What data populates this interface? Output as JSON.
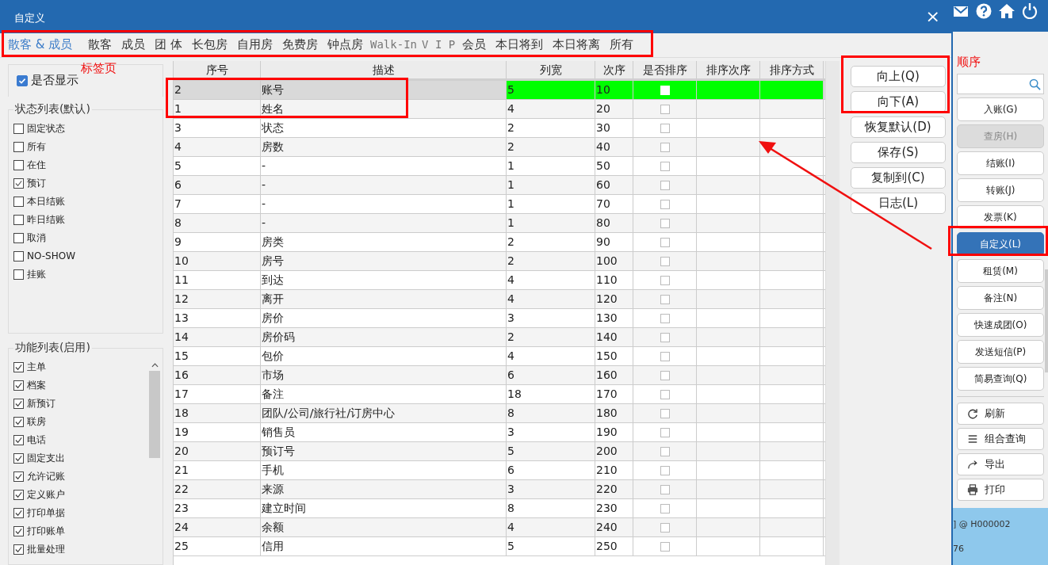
{
  "window": {
    "title": "自定义",
    "close": "×"
  },
  "tabs": [
    {
      "label": "散客 & 成员",
      "selected": true
    },
    {
      "label": "散客",
      "selected": false
    },
    {
      "label": "成员",
      "selected": false
    },
    {
      "label": "团 体",
      "selected": false
    },
    {
      "label": "长包房",
      "selected": false
    },
    {
      "label": "自用房",
      "selected": false
    },
    {
      "label": "免费房",
      "selected": false
    },
    {
      "label": "钟点房",
      "selected": false
    },
    {
      "label": "Walk-In",
      "selected": false,
      "kind": "mono"
    },
    {
      "label": "V I P",
      "selected": false,
      "kind": "mono"
    },
    {
      "label": "会员",
      "selected": false
    },
    {
      "label": "本日将到",
      "selected": false
    },
    {
      "label": "本日将离",
      "selected": false
    },
    {
      "label": "所有",
      "selected": false
    }
  ],
  "show_toggle": {
    "label": "是否显示",
    "checked": true
  },
  "status_list": {
    "title": "状态列表(默认)",
    "items": [
      {
        "label": "固定状态",
        "checked": false
      },
      {
        "label": "所有",
        "checked": false
      },
      {
        "label": "在住",
        "checked": false
      },
      {
        "label": "预订",
        "checked": true
      },
      {
        "label": "本日结账",
        "checked": false
      },
      {
        "label": "昨日结账",
        "checked": false
      },
      {
        "label": "取消",
        "checked": false
      },
      {
        "label": "NO-SHOW",
        "checked": false
      },
      {
        "label": "挂账",
        "checked": false
      }
    ]
  },
  "function_list": {
    "title": "功能列表(启用)",
    "items": [
      {
        "label": "主单",
        "checked": true
      },
      {
        "label": "档案",
        "checked": true
      },
      {
        "label": "新预订",
        "checked": true
      },
      {
        "label": "联房",
        "checked": true
      },
      {
        "label": "电话",
        "checked": true
      },
      {
        "label": "固定支出",
        "checked": true
      },
      {
        "label": "允许记账",
        "checked": true
      },
      {
        "label": "定义账户",
        "checked": true
      },
      {
        "label": "打印单据",
        "checked": true
      },
      {
        "label": "打印账单",
        "checked": true
      },
      {
        "label": "批量处理",
        "checked": true
      }
    ]
  },
  "table": {
    "columns": [
      "序号",
      "描述",
      "列宽",
      "次序",
      "是否排序",
      "排序次序",
      "排序方式"
    ],
    "rows": [
      {
        "cells": [
          "2",
          "账号",
          "5",
          "10"
        ],
        "sorted": false,
        "selected": true
      },
      {
        "cells": [
          "1",
          "姓名",
          "4",
          "20"
        ],
        "sorted": false,
        "selected": false
      },
      {
        "cells": [
          "3",
          "状态",
          "2",
          "30"
        ],
        "sorted": false,
        "selected": false
      },
      {
        "cells": [
          "4",
          "房数",
          "2",
          "40"
        ],
        "sorted": false,
        "selected": false
      },
      {
        "cells": [
          "5",
          "-",
          "1",
          "50"
        ],
        "sorted": false,
        "selected": false
      },
      {
        "cells": [
          "6",
          "-",
          "1",
          "60"
        ],
        "sorted": false,
        "selected": false
      },
      {
        "cells": [
          "7",
          "-",
          "1",
          "70"
        ],
        "sorted": false,
        "selected": false
      },
      {
        "cells": [
          "8",
          "-",
          "1",
          "80"
        ],
        "sorted": false,
        "selected": false
      },
      {
        "cells": [
          "9",
          "房类",
          "2",
          "90"
        ],
        "sorted": false,
        "selected": false
      },
      {
        "cells": [
          "10",
          "房号",
          "2",
          "100"
        ],
        "sorted": false,
        "selected": false
      },
      {
        "cells": [
          "11",
          "到达",
          "4",
          "110"
        ],
        "sorted": false,
        "selected": false
      },
      {
        "cells": [
          "12",
          "离开",
          "4",
          "120"
        ],
        "sorted": false,
        "selected": false
      },
      {
        "cells": [
          "13",
          "房价",
          "3",
          "130"
        ],
        "sorted": false,
        "selected": false
      },
      {
        "cells": [
          "14",
          "房价码",
          "2",
          "140"
        ],
        "sorted": false,
        "selected": false
      },
      {
        "cells": [
          "15",
          "包价",
          "4",
          "150"
        ],
        "sorted": false,
        "selected": false
      },
      {
        "cells": [
          "16",
          "市场",
          "6",
          "160"
        ],
        "sorted": false,
        "selected": false
      },
      {
        "cells": [
          "17",
          "备注",
          "18",
          "170"
        ],
        "sorted": false,
        "selected": false
      },
      {
        "cells": [
          "18",
          "团队/公司/旅行社/订房中心",
          "8",
          "180"
        ],
        "sorted": false,
        "selected": false
      },
      {
        "cells": [
          "19",
          "销售员",
          "3",
          "190"
        ],
        "sorted": false,
        "selected": false
      },
      {
        "cells": [
          "20",
          "预订号",
          "5",
          "200"
        ],
        "sorted": false,
        "selected": false
      },
      {
        "cells": [
          "21",
          "手机",
          "6",
          "210"
        ],
        "sorted": false,
        "selected": false
      },
      {
        "cells": [
          "22",
          "来源",
          "3",
          "220"
        ],
        "sorted": false,
        "selected": false
      },
      {
        "cells": [
          "23",
          "建立时间",
          "8",
          "230"
        ],
        "sorted": false,
        "selected": false
      },
      {
        "cells": [
          "24",
          "余额",
          "4",
          "240"
        ],
        "sorted": false,
        "selected": false
      },
      {
        "cells": [
          "25",
          "信用",
          "5",
          "250"
        ],
        "sorted": false,
        "selected": false
      }
    ]
  },
  "actions": [
    "向上(Q)",
    "向下(A)",
    "恢复默认(D)",
    "保存(S)",
    "复制到(C)",
    "日志(L)"
  ],
  "side_panel": {
    "buttons": [
      {
        "label": "入账(G)",
        "disabled": false,
        "selected": false
      },
      {
        "label": "查房(H)",
        "disabled": true,
        "selected": false
      },
      {
        "label": "结账(I)",
        "disabled": false,
        "selected": false
      },
      {
        "label": "转账(J)",
        "disabled": false,
        "selected": false
      },
      {
        "label": "发票(K)",
        "disabled": false,
        "selected": false
      },
      {
        "label": "自定义(L)",
        "disabled": false,
        "selected": true
      },
      {
        "label": "租赁(M)",
        "disabled": false,
        "selected": false
      },
      {
        "label": "备注(N)",
        "disabled": false,
        "selected": false
      },
      {
        "label": "快速成团(O)",
        "disabled": false,
        "selected": false
      },
      {
        "label": "发送短信(P)",
        "disabled": false,
        "selected": false
      },
      {
        "label": "简易查询(Q)",
        "disabled": false,
        "selected": false
      }
    ],
    "tools": [
      {
        "label": "刷新",
        "kind": "refresh"
      },
      {
        "label": "组合查询",
        "kind": "list"
      },
      {
        "label": "导出",
        "kind": "export"
      },
      {
        "label": "打印",
        "kind": "print"
      }
    ],
    "status": [
      "] @ H000002",
      "76"
    ]
  },
  "annotations": {
    "tabs_label": "标签页",
    "order_label": "顺序"
  }
}
